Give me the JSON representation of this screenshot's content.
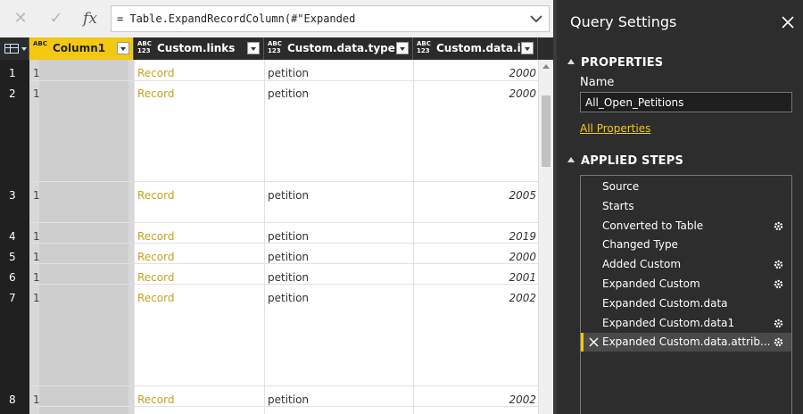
{
  "formula_bar": {
    "text": "= Table.ExpandRecordColumn(#\"Expanded"
  },
  "grid": {
    "columns": [
      {
        "type": "ABC",
        "type2": "",
        "name": "Column1",
        "selected": true
      },
      {
        "type": "ABC",
        "type2": "123",
        "name": "Custom.links",
        "selected": false
      },
      {
        "type": "ABC",
        "type2": "123",
        "name": "Custom.data.type",
        "selected": false
      },
      {
        "type": "ABC",
        "type2": "123",
        "name": "Custom.data.id",
        "selected": false
      }
    ],
    "rows": [
      {
        "n": "1",
        "c1": "1",
        "links": "Record",
        "type": "petition",
        "id": "2000"
      },
      {
        "n": "2",
        "c1": "1",
        "links": "Record",
        "type": "petition",
        "id": "2000"
      },
      {
        "n": "3",
        "c1": "1",
        "links": "Record",
        "type": "petition",
        "id": "2005"
      },
      {
        "n": "4",
        "c1": "1",
        "links": "Record",
        "type": "petition",
        "id": "2019"
      },
      {
        "n": "5",
        "c1": "1",
        "links": "Record",
        "type": "petition",
        "id": "2000"
      },
      {
        "n": "6",
        "c1": "1",
        "links": "Record",
        "type": "petition",
        "id": "2001"
      },
      {
        "n": "7",
        "c1": "1",
        "links": "Record",
        "type": "petition",
        "id": "2002"
      },
      {
        "n": "8",
        "c1": "1",
        "links": "Record",
        "type": "petition",
        "id": "2002"
      }
    ]
  },
  "query_settings": {
    "title": "Query Settings",
    "properties_header": "PROPERTIES",
    "name_label": "Name",
    "name_value": "All_Open_Petitions",
    "all_properties_link": "All Properties",
    "applied_steps_header": "APPLIED STEPS",
    "steps": [
      {
        "label": "Source",
        "gear": false
      },
      {
        "label": "Starts",
        "gear": false
      },
      {
        "label": "Converted to Table",
        "gear": true
      },
      {
        "label": "Changed Type",
        "gear": false
      },
      {
        "label": "Added Custom",
        "gear": true
      },
      {
        "label": "Expanded Custom",
        "gear": true
      },
      {
        "label": "Expanded Custom.data",
        "gear": false
      },
      {
        "label": "Expanded Custom.data1",
        "gear": true
      },
      {
        "label": "Expanded Custom.data.attrib...",
        "gear": true,
        "active": true
      }
    ]
  },
  "colors": {
    "accent": "#f2c811",
    "record_link": "#c8a11d",
    "panel_bg": "#2d2d2d",
    "header_bg": "#2b2b2b"
  },
  "icons": {
    "cancel": "close-icon",
    "commit": "check-icon",
    "function": "fx-icon",
    "expand": "chevron-down-icon",
    "settings": "gear-icon",
    "delete_step": "delete-step-icon"
  }
}
